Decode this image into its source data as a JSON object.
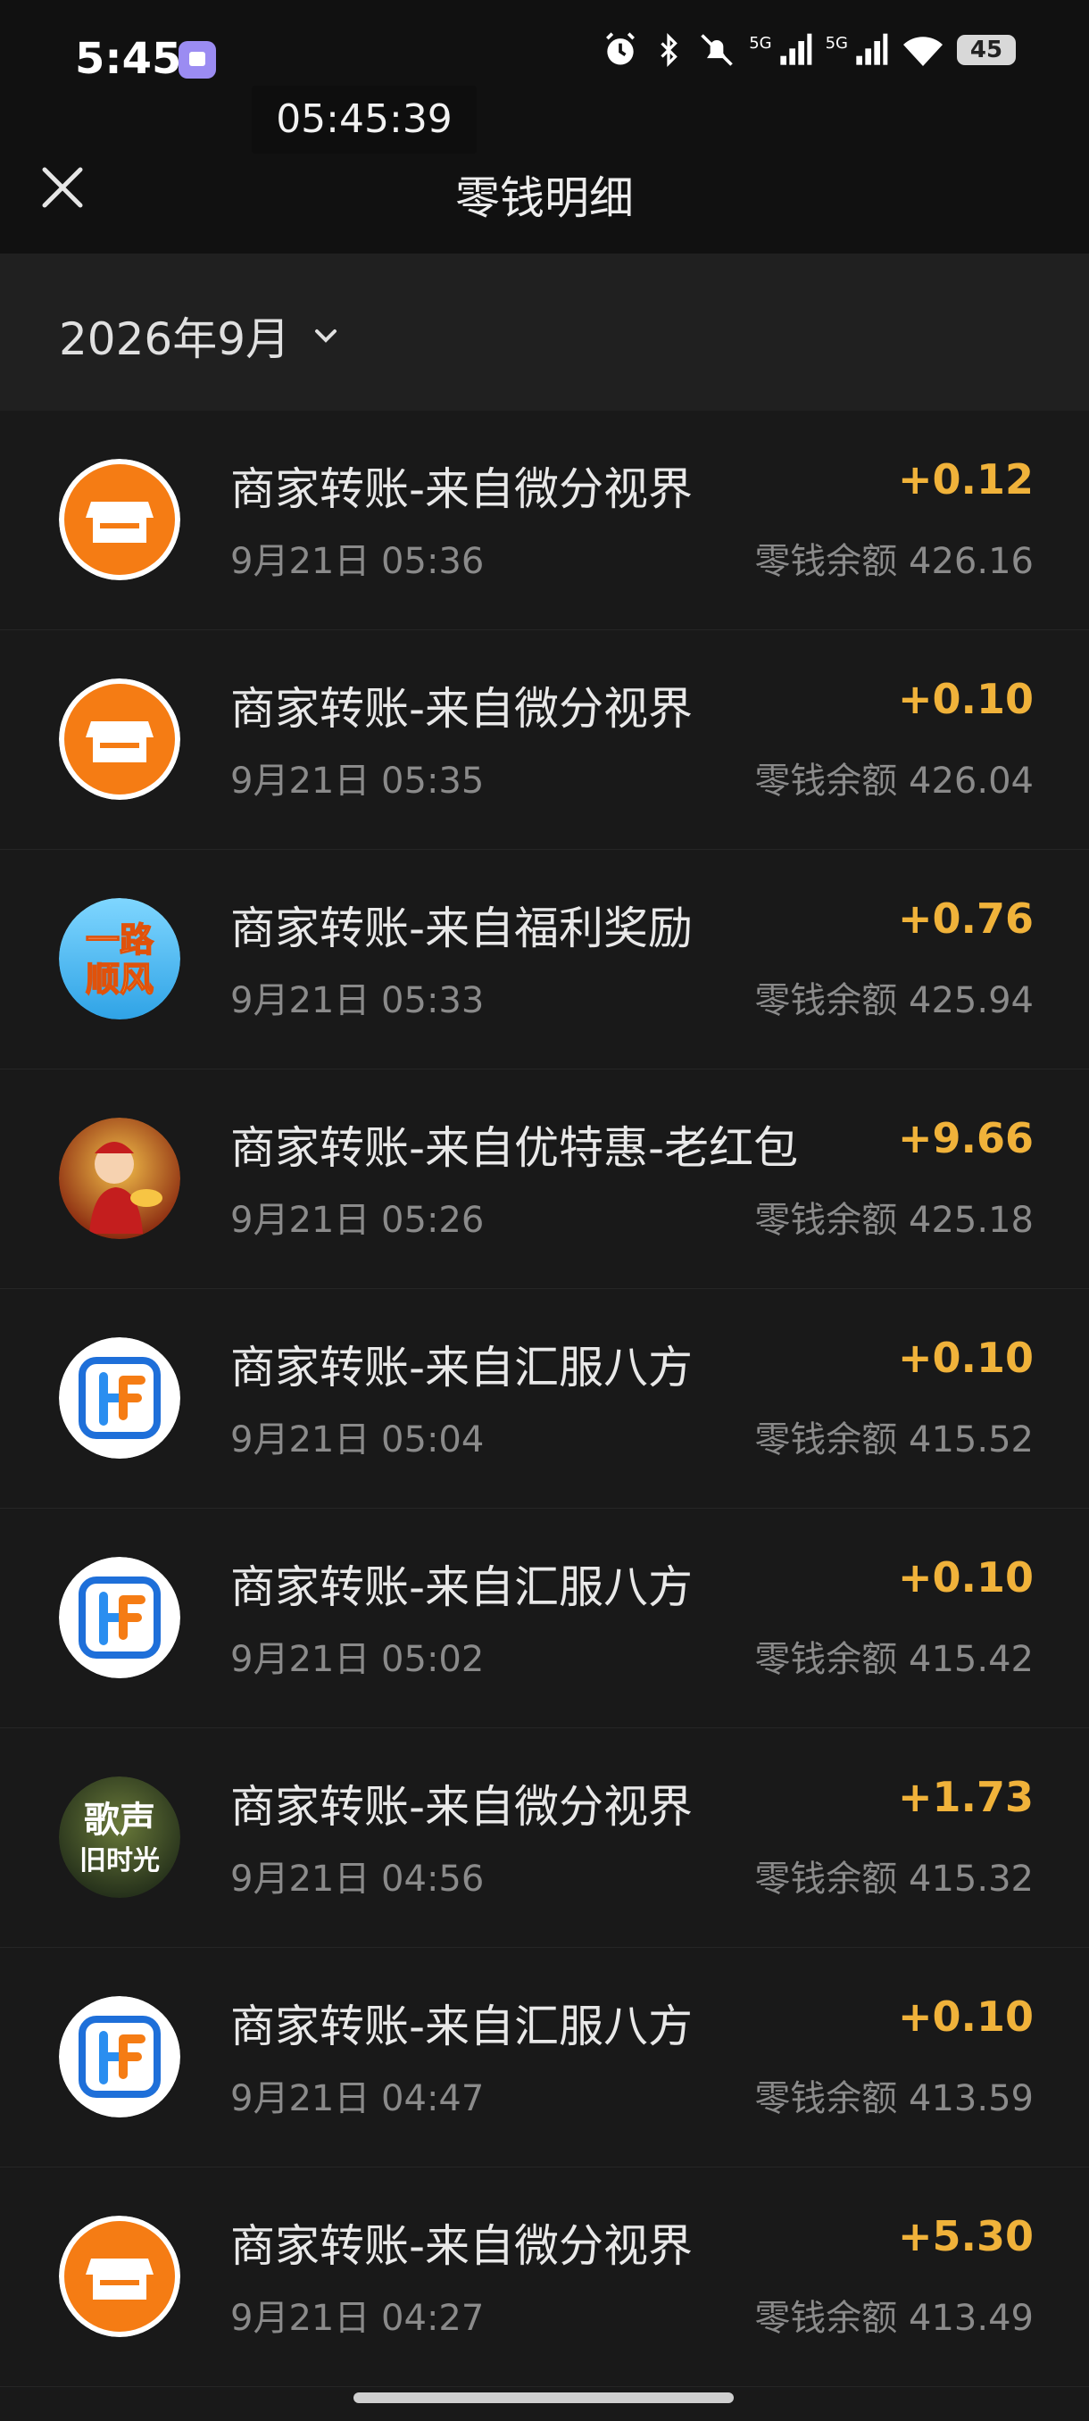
{
  "status_bar": {
    "time": "5:45",
    "battery": "45",
    "net1": "5G",
    "net2": "5G",
    "icons": [
      "alarm-icon",
      "bluetooth-icon",
      "mute-icon",
      "signal-icon",
      "signal-icon",
      "wifi-icon",
      "battery-icon"
    ]
  },
  "overlay_clock": "05:45:39",
  "header": {
    "title": "零钱明细",
    "close_icon": "close-icon"
  },
  "filter": {
    "month": "2026年9月",
    "icon": "chevron-down-icon"
  },
  "colors": {
    "amount": "#f0b23a",
    "background": "#191919",
    "nav": "#111111"
  },
  "transactions": [
    {
      "title": "商家转账-来自微分视界",
      "time": "9月21日 05:36",
      "amount": "+0.12",
      "balance": "零钱余额 426.16",
      "avatar": "shop-icon"
    },
    {
      "title": "商家转账-来自微分视界",
      "time": "9月21日 05:35",
      "amount": "+0.10",
      "balance": "零钱余额 426.04",
      "avatar": "shop-icon"
    },
    {
      "title": "商家转账-来自福利奖励",
      "time": "9月21日 05:33",
      "amount": "+0.76",
      "balance": "零钱余额 425.94",
      "avatar": "yilu-shunfeng-logo",
      "avatar_text": [
        "一路",
        "顺风"
      ]
    },
    {
      "title": "商家转账-来自优特惠-老红包",
      "time": "9月21日 05:26",
      "amount": "+9.66",
      "balance": "零钱余额 425.18",
      "avatar": "fortune-god-avatar"
    },
    {
      "title": "商家转账-来自汇服八方",
      "time": "9月21日 05:04",
      "amount": "+0.10",
      "balance": "零钱余额 415.52",
      "avatar": "hf-logo"
    },
    {
      "title": "商家转账-来自汇服八方",
      "time": "9月21日 05:02",
      "amount": "+0.10",
      "balance": "零钱余额 415.42",
      "avatar": "hf-logo"
    },
    {
      "title": "商家转账-来自微分视界",
      "time": "9月21日 04:56",
      "amount": "+1.73",
      "balance": "零钱余额 415.32",
      "avatar": "gesheng-logo",
      "avatar_text": [
        "歌声",
        "旧时光"
      ]
    },
    {
      "title": "商家转账-来自汇服八方",
      "time": "9月21日 04:47",
      "amount": "+0.10",
      "balance": "零钱余额 413.59",
      "avatar": "hf-logo"
    },
    {
      "title": "商家转账-来自微分视界",
      "time": "9月21日 04:27",
      "amount": "+5.30",
      "balance": "零钱余额 413.49",
      "avatar": "shop-icon"
    }
  ]
}
